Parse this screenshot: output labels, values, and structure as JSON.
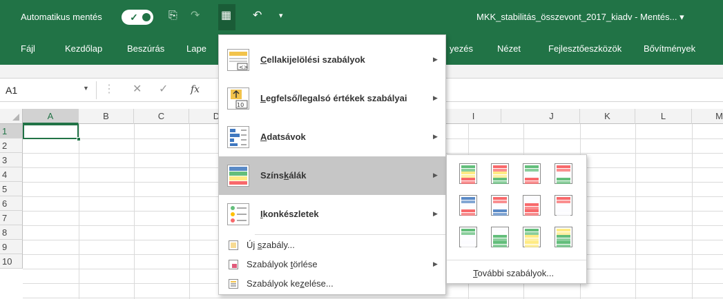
{
  "titlebar": {
    "autosave_label": "Automatikus mentés",
    "filename": "MKK_stabilitás_összevont_2017_kiadv - Mentés... ▾",
    "toggle_check": "✓",
    "save_icon": "⎘",
    "redo_icon": "↷",
    "undo_icon": "↶",
    "customize_icon": "▾",
    "conditional_format_icon": "▦"
  },
  "ribbon": {
    "tabs": [
      "Fájl",
      "Kezdőlap",
      "Beszúrás",
      "Lape",
      "yezés",
      "Nézet",
      "Fejlesztőeszközök",
      "Bővítmények"
    ]
  },
  "formula_bar": {
    "name_box": "A1",
    "cancel_icon": "✕",
    "confirm_icon": "✓",
    "fx_label": "fx",
    "separator": "⋮",
    "dropdown_arrow": "▼"
  },
  "grid": {
    "columns": [
      "A",
      "B",
      "C",
      "D",
      "I",
      "J",
      "K",
      "L",
      "M"
    ],
    "rows": [
      "1",
      "2",
      "3",
      "4",
      "5",
      "6",
      "7",
      "8",
      "9",
      "10"
    ]
  },
  "menu": {
    "items": [
      {
        "pre": "",
        "key": "C",
        "post": "ellakijelölési szabályok",
        "icon": "highlight-cells-rules-icon"
      },
      {
        "pre": "",
        "key": "L",
        "post": "egfelső/legalsó értékek szabályai",
        "icon": "top-bottom-rules-icon"
      },
      {
        "pre": "",
        "key": "A",
        "post": "datsávok",
        "icon": "data-bars-icon"
      },
      {
        "pre": "Színs",
        "key": "k",
        "post": "álák",
        "icon": "color-scales-icon"
      },
      {
        "pre": "",
        "key": "I",
        "post": "konkészletek",
        "icon": "icon-sets-icon"
      }
    ],
    "small_items": [
      {
        "pre": "Új ",
        "key": "s",
        "post": "zabály...",
        "icon": "new-rule-icon"
      },
      {
        "pre": "Szabályok ",
        "key": "t",
        "post": "örlése",
        "icon": "clear-rules-icon"
      },
      {
        "pre": "Szabályok ke",
        "key": "z",
        "post": "elése...",
        "icon": "manage-rules-icon"
      }
    ],
    "submenu_arrow": "▶",
    "top_bottom_number": "10"
  },
  "submenu": {
    "more_pre": "",
    "more_key": "T",
    "more_post": "ovábbi szabályok...",
    "scales": [
      [
        "#63be7b",
        "#ffeb84",
        "#f8696b"
      ],
      [
        "#f8696b",
        "#ffeb84",
        "#63be7b"
      ],
      [
        "#63be7b",
        "#fcfcff",
        "#f8696b"
      ],
      [
        "#f8696b",
        "#fcfcff",
        "#63be7b"
      ],
      [
        "#5a8ac6",
        "#fcfcff",
        "#f8696b"
      ],
      [
        "#f8696b",
        "#fcfcff",
        "#5a8ac6"
      ],
      [
        "#fcfcff",
        "#f8696b",
        "#f8696b"
      ],
      [
        "#f8696b",
        "#fcfcff",
        "#fcfcff"
      ],
      [
        "#63be7b",
        "#fcfcff",
        "#fcfcff"
      ],
      [
        "#fcfcff",
        "#63be7b",
        "#63be7b"
      ],
      [
        "#63be7b",
        "#ffeb84",
        "#ffeb84"
      ],
      [
        "#ffeb84",
        "#63be7b",
        "#63be7b"
      ]
    ]
  },
  "colors": {
    "excel_green": "#217346",
    "menu_highlight": "#c6c6c6"
  }
}
